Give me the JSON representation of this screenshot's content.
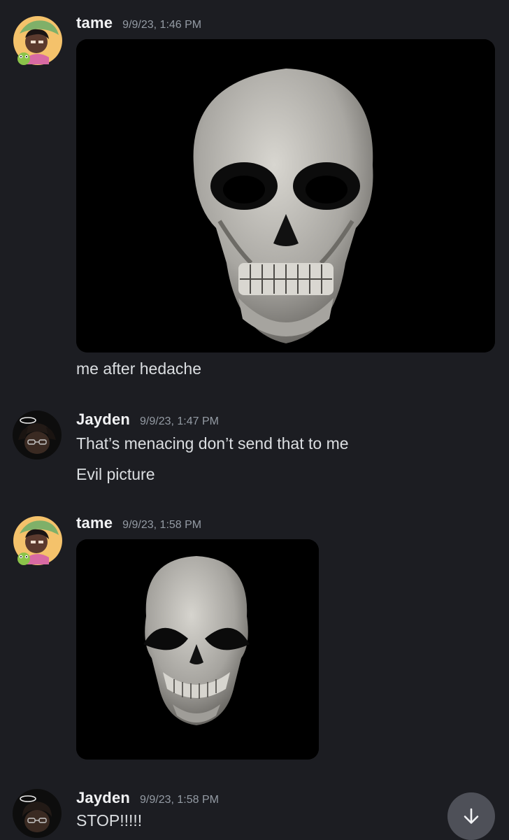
{
  "messages": [
    {
      "author": "tame",
      "timestamp": "9/9/23, 1:46 PM",
      "attachment": "skull-image",
      "text": "me after hedache"
    },
    {
      "author": "Jayden",
      "timestamp": "9/9/23, 1:47 PM",
      "lines": [
        "That’s menacing don’t send that to me",
        "Evil picture"
      ]
    },
    {
      "author": "tame",
      "timestamp": "9/9/23, 1:58 PM",
      "attachment": "squished-skull-image"
    },
    {
      "author": "Jayden",
      "timestamp": "9/9/23, 1:58 PM",
      "lines": [
        "STOP!!!!!"
      ]
    }
  ],
  "scroll_button": {
    "icon": "arrow-down-icon"
  },
  "colors": {
    "background": "#1c1d22",
    "username": "#f2f3f5",
    "timestamp": "#949ba4",
    "message_text": "#dbdee1",
    "scroll_button": "#4e5058"
  }
}
